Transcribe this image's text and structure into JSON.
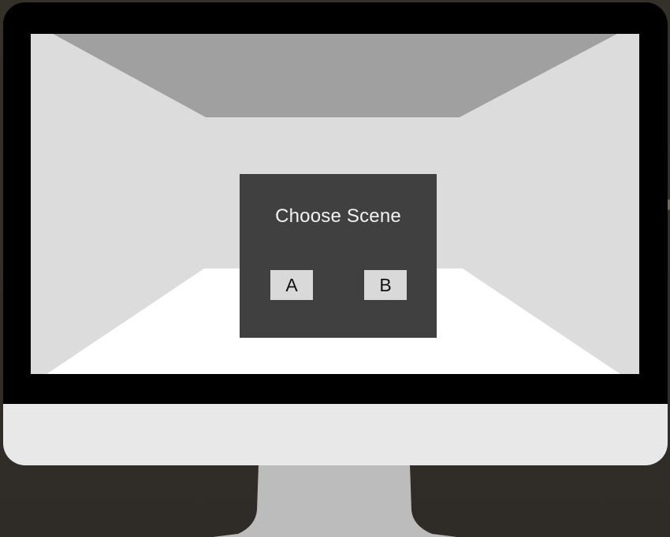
{
  "scene_menu": {
    "title": "Choose Scene",
    "options": [
      {
        "label": "A"
      },
      {
        "label": "B"
      }
    ]
  },
  "colors": {
    "background": "#312e28",
    "bezel": "#000000",
    "chin": "#e8e8e8",
    "stand": "#bcbcbc",
    "screen_wall": "#dcdcdc",
    "screen_ceiling": "#a0a0a0",
    "screen_floor": "#ffffff",
    "panel": "#404040",
    "button": "#d9d9d9"
  }
}
